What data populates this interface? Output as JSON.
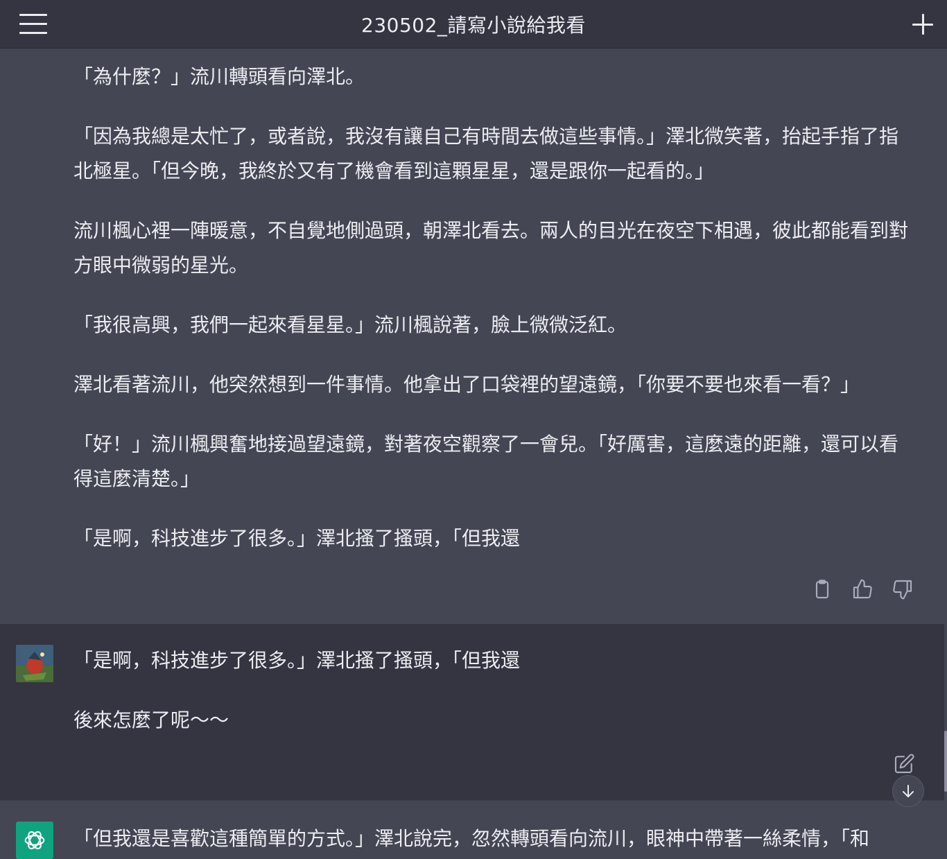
{
  "header": {
    "title": "230502_請寫小說給我看"
  },
  "icons": {
    "menu": "menu-icon",
    "new_chat": "plus-icon",
    "copy": "clipboard-icon",
    "thumbs_up": "thumbs-up-icon",
    "thumbs_down": "thumbs-down-icon",
    "edit": "edit-icon",
    "scroll_down": "arrow-down-icon"
  },
  "conversation": {
    "assistant_message_1": {
      "paragraphs": [
        "「為什麼？」流川轉頭看向澤北。",
        "「因為我總是太忙了，或者說，我沒有讓自己有時間去做這些事情。」澤北微笑著，抬起手指了指北極星。「但今晚，我終於又有了機會看到這顆星星，還是跟你一起看的。」",
        "流川楓心裡一陣暖意，不自覺地側過頭，朝澤北看去。兩人的目光在夜空下相遇，彼此都能看到對方眼中微弱的星光。",
        "「我很高興，我們一起來看星星。」流川楓說著，臉上微微泛紅。",
        "澤北看著流川，他突然想到一件事情。他拿出了口袋裡的望遠鏡，「你要不要也來看一看？」",
        "「好！」流川楓興奮地接過望遠鏡，對著夜空觀察了一會兒。「好厲害，這麼遠的距離，還可以看得這麼清楚。」",
        "「是啊，科技進步了很多。」澤北搔了搔頭，「但我還"
      ]
    },
    "user_message": {
      "paragraphs": [
        "「是啊，科技進步了很多。」澤北搔了搔頭，「但我還",
        "後來怎麼了呢～～"
      ]
    },
    "assistant_message_2": {
      "paragraphs": [
        "「但我還是喜歡這種簡單的方式。」澤北說完，忽然轉頭看向流川，眼神中帶著一絲柔情，「和"
      ]
    }
  },
  "colors": {
    "assistant_bg": "#444654",
    "user_bg": "#343541",
    "accent": "#10a37f",
    "text": "#ececf1"
  }
}
